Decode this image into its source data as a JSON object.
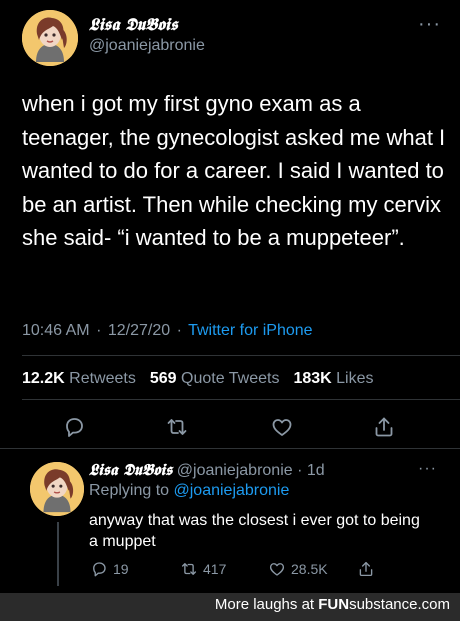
{
  "tweet": {
    "display_name": "𝕷𝖎𝖘𝖆 𝕯𝖚𝕭𝖔𝖎𝖘",
    "handle": "@joaniejabronie",
    "more": "···",
    "text": "when i got my first gyno exam as a teenager, the gynecologist asked me what I wanted to do for a career. I said I wanted to be an artist. Then while checking my cervix she said- “i wanted to be a muppeteer”.",
    "time": "10:46 AM",
    "date": "12/27/20",
    "source": "Twitter for iPhone",
    "retweets_count": "12.2K",
    "retweets_label": "Retweets",
    "quotes_count": "569",
    "quotes_label": "Quote Tweets",
    "likes_count": "183K",
    "likes_label": "Likes"
  },
  "reply": {
    "display_name": "𝕷𝖎𝖘𝖆 𝕯𝖚𝕭𝖔𝖎𝖘",
    "handle": "@joaniejabronie",
    "age": "1d",
    "more": "···",
    "replying_prefix": "Replying to",
    "replying_to": "@joaniejabronie",
    "text": "anyway that was the closest i ever got to being a muppet",
    "reply_count": "19",
    "retweet_count": "417",
    "like_count": "28.5K"
  },
  "footer": {
    "prefix": "More laughs at",
    "brand_a": "FUN",
    "brand_b": "substance",
    "brand_c": ".com"
  },
  "icons": {
    "reply": "reply-icon",
    "retweet": "retweet-icon",
    "like": "heart-icon",
    "share": "share-icon"
  },
  "colors": {
    "background": "#000000",
    "secondary_text": "#8b98a5",
    "link": "#1d9bf0",
    "avatar_bg": "#f3c76d",
    "footer_bg": "#2b2b2b"
  }
}
